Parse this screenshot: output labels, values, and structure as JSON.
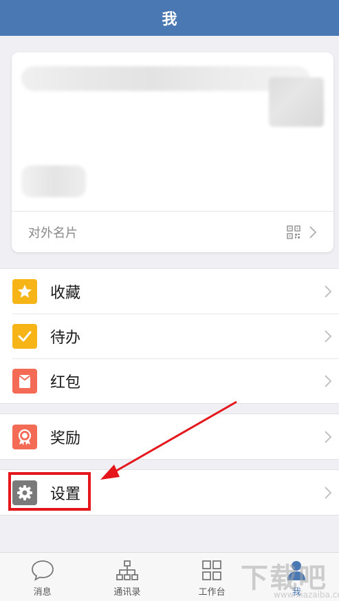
{
  "header": {
    "title": "我"
  },
  "profile": {
    "card_label": "对外名片"
  },
  "menu": {
    "group1": [
      {
        "label": "收藏",
        "icon": "star-icon",
        "color": "#f6b417"
      },
      {
        "label": "待办",
        "icon": "checkmark-icon",
        "color": "#f6b417"
      },
      {
        "label": "红包",
        "icon": "red-envelope-icon",
        "color": "#f36b55"
      }
    ],
    "group2": [
      {
        "label": "奖励",
        "icon": "award-icon",
        "color": "#f36b55"
      }
    ],
    "group3": [
      {
        "label": "设置",
        "icon": "gear-icon",
        "color": "#7a7a7a"
      }
    ]
  },
  "tabs": [
    {
      "label": "消息",
      "icon": "chat-bubble-icon"
    },
    {
      "label": "通讯录",
      "icon": "org-chart-icon"
    },
    {
      "label": "工作台",
      "icon": "grid-icon"
    },
    {
      "label": "我",
      "icon": "person-icon",
      "active": true
    }
  ],
  "watermark": {
    "text": "下载吧",
    "url": "www.xiazaiba.com"
  },
  "colors": {
    "header": "#4a78b2",
    "highlight": "#e4151b"
  }
}
